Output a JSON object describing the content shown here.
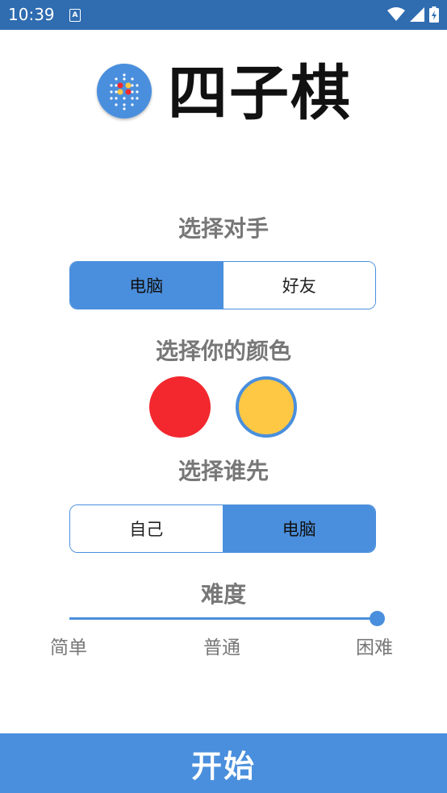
{
  "status_bar": {
    "time": "10:39",
    "notification_glyph": "A",
    "icons": [
      "wifi-icon",
      "signal-icon",
      "battery-icon"
    ]
  },
  "app": {
    "title": "四子棋",
    "logo_icon": "connect-four-icon"
  },
  "opponent": {
    "label": "选择对手",
    "options": [
      "电脑",
      "好友"
    ],
    "selected": 0
  },
  "color": {
    "label": "选择你的颜色",
    "options": [
      {
        "name": "red",
        "hex": "#f2282e"
      },
      {
        "name": "yellow",
        "hex": "#ffc844"
      }
    ],
    "selected": 1
  },
  "first": {
    "label": "选择谁先",
    "options": [
      "自己",
      "电脑"
    ],
    "selected": 1
  },
  "difficulty": {
    "label": "难度",
    "ticks": [
      "简单",
      "普通",
      "困难"
    ],
    "value": "困难"
  },
  "start_button": {
    "label": "开始"
  },
  "theme": {
    "accent": "#4a8fdd",
    "statusbar": "#2f6cb0"
  }
}
